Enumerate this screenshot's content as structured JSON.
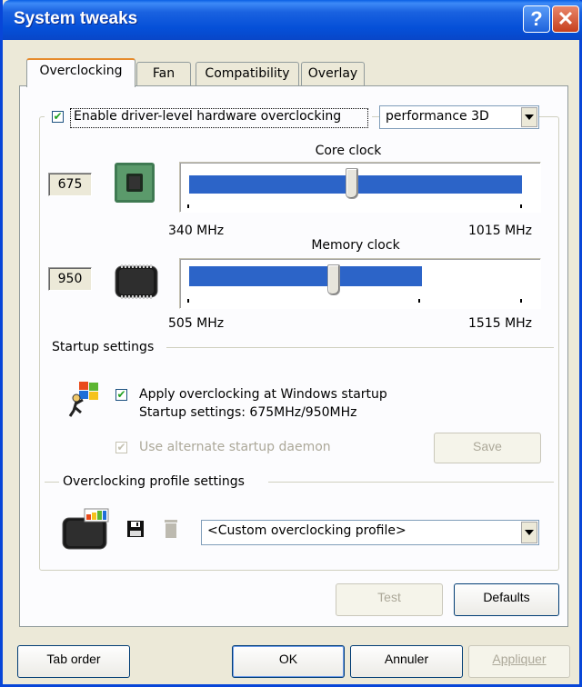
{
  "window": {
    "title": "System tweaks",
    "help_glyph": "?",
    "close_glyph": "✕"
  },
  "tabs": [
    {
      "label": "Overclocking",
      "active": true
    },
    {
      "label": "Fan",
      "active": false
    },
    {
      "label": "Compatibility",
      "active": false
    },
    {
      "label": "Overlay",
      "active": false
    }
  ],
  "overclocking": {
    "enable_label": "Enable driver-level hardware overclocking",
    "enable_checked": true,
    "mode_select": "performance 3D",
    "core": {
      "title": "Core clock",
      "value": "675",
      "min_label": "340 MHz",
      "max_label": "1015 MHz",
      "min": 340,
      "max": 1015,
      "current": 675,
      "fill_fraction": 1.0
    },
    "memory": {
      "title": "Memory clock",
      "value": "950",
      "min_label": "505 MHz",
      "max_label": "1515 MHz",
      "min": 505,
      "max": 1515,
      "current": 950,
      "fill_fraction": 0.68
    }
  },
  "startup": {
    "section_title": "Startup settings",
    "apply_label": "Apply overclocking at Windows startup",
    "apply_checked": true,
    "summary": "Startup settings: 675MHz/950MHz",
    "daemon_label": "Use alternate startup daemon",
    "daemon_checked": true,
    "daemon_disabled": true,
    "save_label": "Save"
  },
  "profile": {
    "section_title": "Overclocking profile settings",
    "selected": "<Custom overclocking profile>"
  },
  "panel_buttons": {
    "test": "Test",
    "defaults": "Defaults"
  },
  "footer": {
    "tab_order": "Tab order",
    "ok": "OK",
    "cancel": "Annuler",
    "apply": "Appliquer"
  },
  "icons": {
    "gpu_chip": "gpu-chip-icon",
    "memory_chip": "memory-chip-icon",
    "startup": "windows-startup-icon",
    "profile": "profile-chip-icon",
    "save": "floppy-save-icon",
    "delete": "trash-delete-icon"
  },
  "colors": {
    "title_bar": "#0a5fe4",
    "slider_fill": "#2c64c8",
    "active_tab_accent": "#e68b2c"
  }
}
